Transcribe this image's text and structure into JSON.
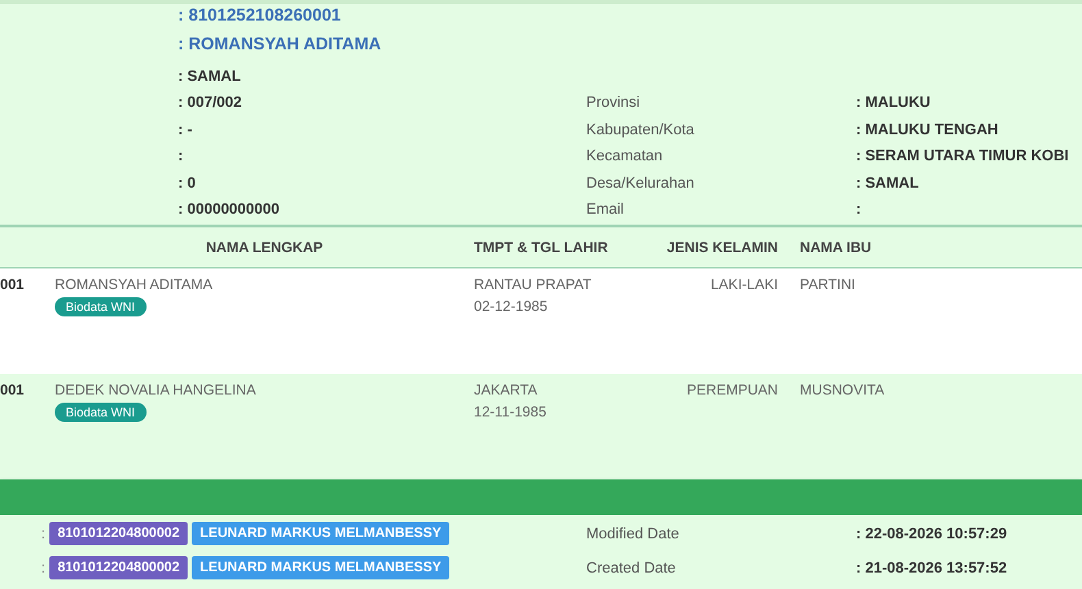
{
  "details": [
    {
      "value": ": 8101252108260001",
      "kind": "primary"
    },
    {
      "value": ": ROMANSYAH ADITAMA",
      "kind": "primary"
    },
    {
      "value": ": SAMAL",
      "kind": "plain"
    },
    {
      "value": ": 007/002",
      "kind": "plain",
      "label": "Provinsi",
      "label_value": ": MALUKU"
    },
    {
      "value": ": -",
      "kind": "plain",
      "label": "Kabupaten/Kota",
      "label_value": ": MALUKU TENGAH"
    },
    {
      "value": ":",
      "kind": "plain",
      "label": "Kecamatan",
      "label_value": ": SERAM UTARA TIMUR KOBI"
    },
    {
      "value": ": 0",
      "kind": "plain",
      "label": "Desa/Kelurahan",
      "label_value": ": SAMAL"
    },
    {
      "value": ": 00000000000",
      "kind": "plain",
      "label": "Email",
      "label_value": ":"
    }
  ],
  "table": {
    "columns": [
      "NAMA LENGKAP",
      "TMPT & TGL LAHIR",
      "JENIS KELAMIN",
      "NAMA IBU"
    ],
    "rows": [
      {
        "column_1": "001",
        "name": "ROMANSYAH ADITAMA",
        "badge": "Biodata WNI",
        "place": "RANTAU PRAPAT",
        "date": "02-12-1985",
        "gender": "LAKI-LAKI",
        "mother": "PARTINI"
      },
      {
        "column_1": "001",
        "name": "DEDEK NOVALIA HANGELINA",
        "badge": "Biodata WNI",
        "place": "JAKARTA",
        "date": "12-11-1985",
        "gender": "PEREMPUAN",
        "mother": "MUSNOVITA"
      }
    ]
  },
  "audit": [
    {
      "separator": ":",
      "nik": "8101012204800002",
      "operator": "LEUNARD MARKUS MELMANBESSY",
      "label": "Modified Date",
      "value": ": 22-08-2026 10:57:29"
    },
    {
      "separator": ":",
      "nik": "8101012204800002",
      "operator": "LEUNARD MARKUS MELMANBESSY",
      "label": "Created Date",
      "value": ": 21-08-2026 13:57:52"
    }
  ]
}
